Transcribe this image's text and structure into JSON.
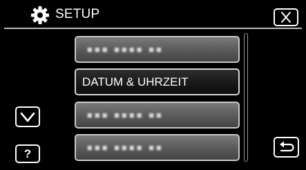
{
  "header": {
    "title": "SETUP",
    "settings_icon": "gear-icon",
    "close_icon": "close-icon"
  },
  "menu": {
    "items": [
      {
        "label": "■■■ ■■■■ ■■",
        "state": "blurred"
      },
      {
        "label": "DATUM & UHRZEIT",
        "state": "selected"
      },
      {
        "label": "■■■ ■■■■ ■■",
        "state": "blurred"
      },
      {
        "label": "■■■ ■■■■ ■■",
        "state": "blurred"
      }
    ]
  },
  "controls": {
    "scroll_down_icon": "chevron-down-icon",
    "help_label": "?",
    "back_icon": "return-arrow-icon"
  },
  "colors": {
    "background": "#000000",
    "item_fill": "#5e5e5e",
    "selected_fill": "#1b1b1b",
    "border": "#c8c8c8"
  }
}
